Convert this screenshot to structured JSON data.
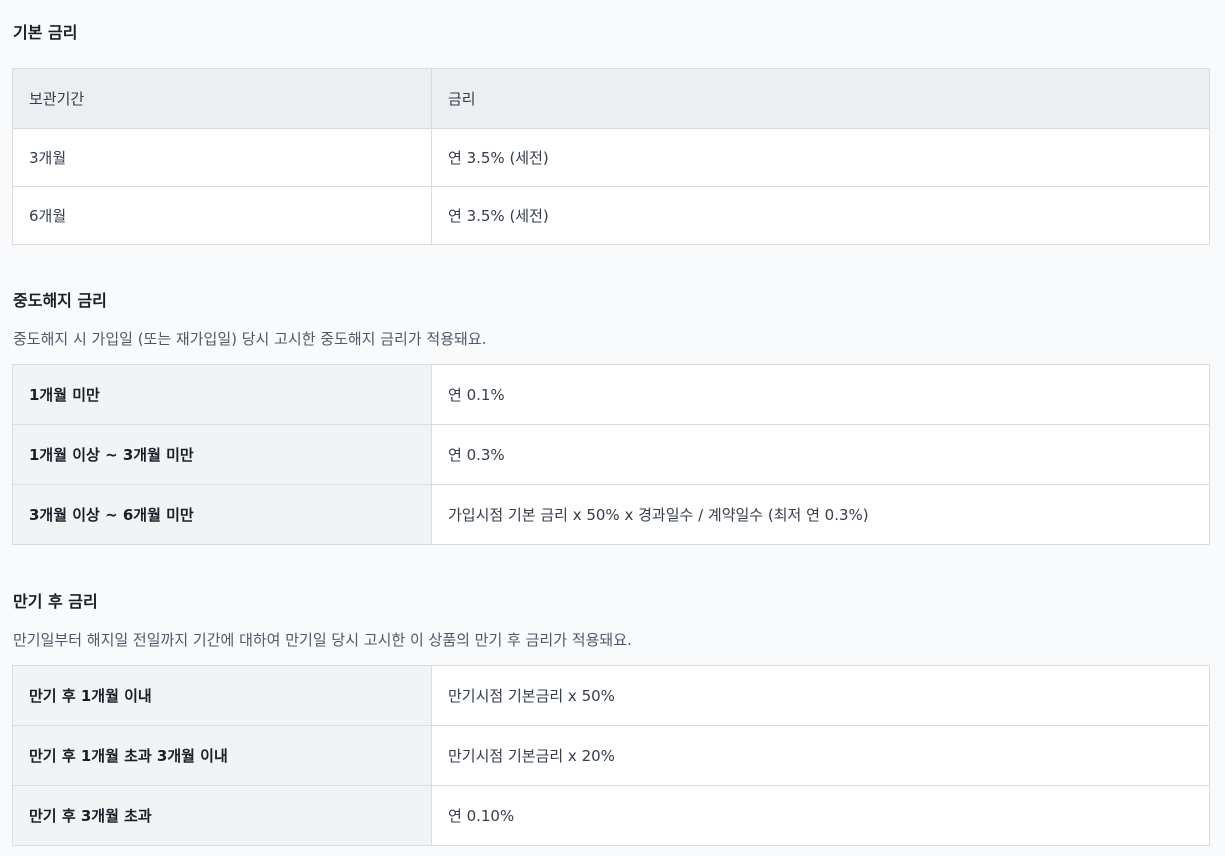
{
  "basic": {
    "title": "기본 금리",
    "headers": [
      "보관기간",
      "금리"
    ],
    "rows": [
      [
        "3개월",
        "연 3.5% (세전)"
      ],
      [
        "6개월",
        "연 3.5% (세전)"
      ]
    ]
  },
  "early": {
    "title": "중도해지 금리",
    "description": "중도해지 시 가입일 (또는 재가입일) 당시 고시한 중도해지 금리가 적용돼요.",
    "rows": [
      [
        "1개월 미만",
        "연 0.1%"
      ],
      [
        "1개월 이상 ~ 3개월 미만",
        "연 0.3%"
      ],
      [
        "3개월 이상 ~ 6개월 미만",
        "가입시점 기본 금리 x 50% x 경과일수 / 계약일수 (최저 연 0.3%)"
      ]
    ]
  },
  "after": {
    "title": "만기 후 금리",
    "description": "만기일부터 해지일 전일까지 기간에 대하여 만기일 당시 고시한 이 상품의 만기 후 금리가 적용돼요.",
    "rows": [
      [
        "만기 후 1개월 이내",
        "만기시점 기본금리 x 50%"
      ],
      [
        "만기 후 1개월 초과 3개월 이내",
        "만기시점 기본금리 x 20%"
      ],
      [
        "만기 후 3개월 초과",
        "연 0.10%"
      ]
    ]
  }
}
